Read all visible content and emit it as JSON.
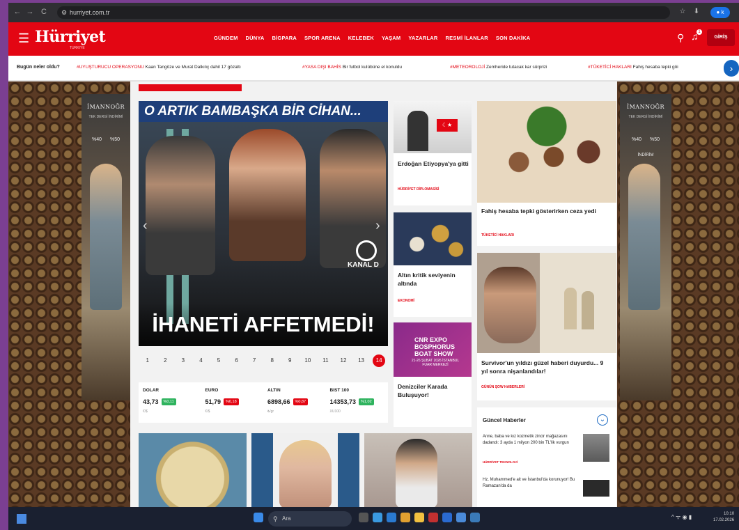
{
  "browser": {
    "url": "hurriyet.com.tr",
    "back": "←",
    "forward": "→",
    "reload": "C",
    "star": "☆",
    "profile": "● k"
  },
  "header": {
    "logo": "Hürriyet",
    "logo_sub": "TURKIYE",
    "nav": [
      "GÜNDEM",
      "DÜNYA",
      "BİGPARA",
      "SPOR ARENA",
      "KELEBEK",
      "YAŞAM",
      "YAZARLAR",
      "RESMİ İLANLAR",
      "SON DAKİKA"
    ],
    "login": "GİRİŞ"
  },
  "ticker": {
    "label": "Bugün neler oldu?",
    "items": [
      {
        "tag": "#UYUŞTURUCU OPERASYONU",
        "text": "Kaan Tangöze ve Murat Dalkılıç dahil 17 gözaltı"
      },
      {
        "tag": "#YASA DIŞI BAHİS",
        "text": "Bir futbol kulübüne el konuldu"
      },
      {
        "tag": "#METEOROLOJİ",
        "text": "Zemheride tutacak kar sürprizi"
      },
      {
        "tag": "#TÜKETİCİ HAKLARI",
        "text": "Fahiş hesaba tepki göi"
      }
    ]
  },
  "ads": {
    "left": {
      "brand": "İMANNOĞR",
      "sub": "TEK DERGİ İNDİRİMİ",
      "pct": "%40 %50"
    },
    "right": {
      "brand": "İMANNOĞR",
      "sub": "TEK DERGİ İNDİRİMİ",
      "pct": "%40 %50",
      "extra": "İNDİRİM"
    }
  },
  "hero": {
    "top_text": "O ARTIK BAMBAŞKA BİR CİHAN...",
    "bottom_text": "İHANETİ AFFETMEDİ!",
    "channel": "KANAL D",
    "pages": [
      "1",
      "2",
      "3",
      "4",
      "5",
      "6",
      "7",
      "8",
      "9",
      "10",
      "11",
      "12",
      "13",
      "14"
    ],
    "active_page": "14"
  },
  "market": [
    {
      "name": "DOLAR",
      "value": "43,73",
      "change": "%0,11",
      "dir": "up",
      "sub": "€/$"
    },
    {
      "name": "EURO",
      "value": "51,79",
      "change": "%0,18",
      "dir": "down",
      "sub": "€/$"
    },
    {
      "name": "ALTIN",
      "value": "6898,66",
      "change": "%0,87",
      "dir": "down",
      "sub": "₺/gr"
    },
    {
      "name": "BIST 100",
      "value": "14353,73",
      "change": "%1,02",
      "dir": "up",
      "sub": "XU100"
    }
  ],
  "cards": {
    "c1": {
      "title": "Erdoğan Etiyopya'ya gitti",
      "category": "HÜRRİYET DİPLOMASİSİ",
      "flag": "☾★"
    },
    "c2": {
      "title": "Altın kritik seviyenin altında",
      "category": "EKONOMİ"
    },
    "c3": {
      "ad_title": "CNR EXPO BOSPHORUS BOAT SHOW",
      "ad_date": "21-26 ŞUBAT 2026 İSTANBUL FUAR MERKEZİ",
      "title": "Denizciler Karada Buluşuyor!"
    },
    "c4": {
      "title": "Fahiş hesaba tepki gösterirken ceza yedi",
      "category": "TÜKETİCİ HAKLARI"
    },
    "c5": {
      "title": "Survivor'un yıldızı güzel haberi duyurdu... 9 yıl sonra nişanlandılar!",
      "category": "GÜNÜN ŞOW HABERLERİ"
    }
  },
  "guncel": {
    "title": "Güncel Haberler",
    "items": [
      {
        "text": "Anne, baba ve kız kozmetik zincir mağazasını dadandı: 3 ayda 1 milyon 200 bin TL'lik vurgun",
        "category": "HÜRRİYET TEKNOLOJİ"
      },
      {
        "text": "Hz. Muhammed'e ait ve İstanbul'da korunuyor! Bu Ramazan'da da",
        "category": ""
      }
    ]
  },
  "taskbar": {
    "search": "Ara",
    "tray": "^ ᯤ ◉ ▮",
    "time": "10:10",
    "date": "17.02.2026"
  },
  "colors": {
    "brand": "#e30613",
    "accent": "#1565c0",
    "up": "#2fb35e"
  }
}
